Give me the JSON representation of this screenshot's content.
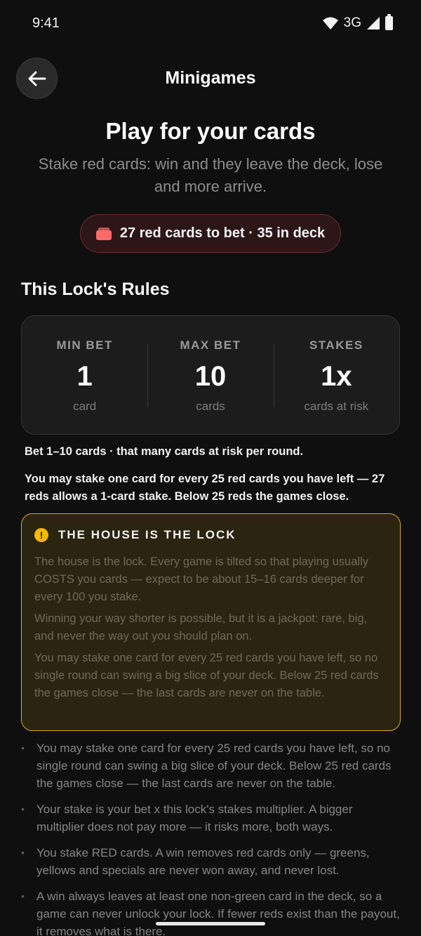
{
  "status": {
    "time": "9:41",
    "network": "3G"
  },
  "header": {
    "title": "Minigames"
  },
  "hero": {
    "title": "Play for your cards",
    "subtitle": "Stake red cards: win and they leave the deck, lose and more arrive."
  },
  "pill": {
    "text": "27 red cards to bet · 35 in deck",
    "icon": "red-cards-icon",
    "accent": "#ff6b6b"
  },
  "rules": {
    "title": "This Lock's Rules",
    "stats": [
      {
        "label": "MIN BET",
        "value": "1",
        "unit": "card"
      },
      {
        "label": "MAX BET",
        "value": "10",
        "unit": "cards"
      },
      {
        "label": "STAKES",
        "value": "1x",
        "unit": "cards at risk"
      }
    ],
    "note1": "Bet 1–10 cards · that many cards at risk per round.",
    "note2": "You may stake one card for every 25 red cards you have left — 27 reds allows a 1-card stake. Below 25 reds the games close."
  },
  "warning": {
    "title": "THE HOUSE IS THE LOCK",
    "color": "#d9a920",
    "paragraphs": [
      "The house is the lock. Every game is tilted so that playing usually COSTS you cards — expect to be about 15–16 cards deeper for every 100 you stake.",
      "Winning your way shorter is possible, but it is a jackpot: rare, big, and never the way out you should plan on.",
      "You may stake one card for every 25 red cards you have left, so no single round can swing a big slice of your deck. Below 25 red cards the games close — the last cards are never on the table."
    ]
  },
  "bullets": [
    "You may stake one card for every 25 red cards you have left, so no single round can swing a big slice of your deck. Below 25 red cards the games close — the last cards are never on the table.",
    "Your stake is your bet x this lock's stakes multiplier. A bigger multiplier does not pay more — it risks more, both ways.",
    "You stake RED cards. A win removes red cards only — greens, yellows and specials are never won away, and never lost.",
    "A win always leaves at least one non-green card in the deck, so a game can never unlock your lock. If fewer reds exist than the payout, it removes what is there."
  ]
}
